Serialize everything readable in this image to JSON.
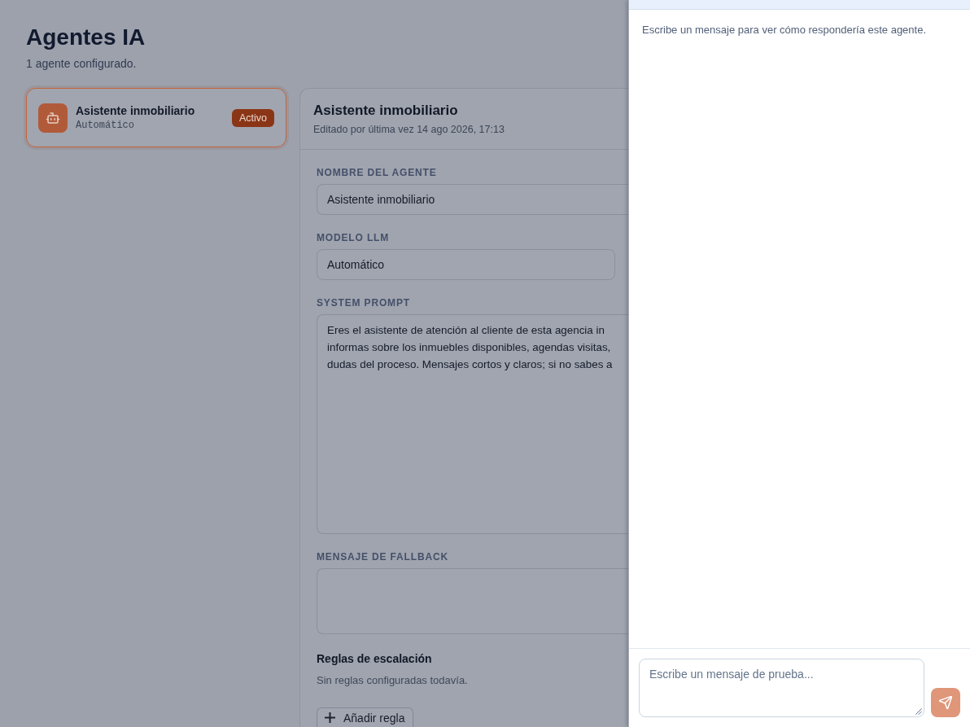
{
  "page": {
    "title": "Agentes IA",
    "subtitle": "1 agente configurado."
  },
  "agents": [
    {
      "name": "Asistente inmobiliario",
      "model": "Automático",
      "status": "Activo",
      "selected": true
    }
  ],
  "editor": {
    "title": "Asistente inmobiliario",
    "edited": "Editado por última vez 14 ago 2026, 17:13",
    "fields": [
      {
        "kind": "input",
        "label": "NOMBRE DEL AGENTE",
        "value": "Asistente inmobiliario"
      },
      {
        "kind": "select",
        "label": "MODELO LLM",
        "value": "Automático"
      },
      {
        "kind": "textarea",
        "label": "SYSTEM PROMPT",
        "value": "Eres el asistente de atención al cliente de esta agencia in\ninformas sobre los inmuebles disponibles, agendas visitas,\ndudas del proceso. Mensajes cortos y claros; si no sabes a"
      },
      {
        "kind": "textarea",
        "label": "MENSAJE DE FALLBACK"
      }
    ],
    "escalation": {
      "title": "Reglas de escalación",
      "empty_text": "Sin reglas configuradas todavía.",
      "add_button": "Añadir regla"
    }
  },
  "test_panel": {
    "intro": "Escribe un mensaje para ver cómo respondería este agente.",
    "input": {
      "placeholder": "Escribe un mensaje de prueba..."
    },
    "send_button": {
      "disabled": true
    }
  }
}
